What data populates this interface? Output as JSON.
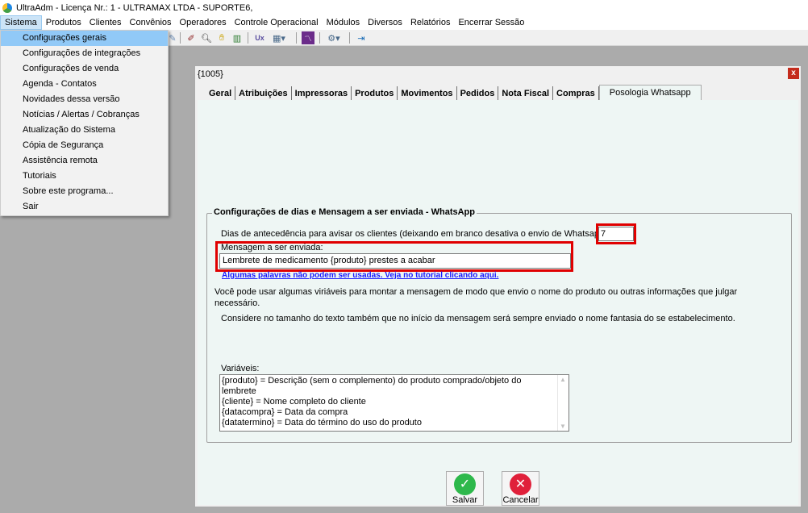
{
  "window": {
    "title": "UltraAdm - Licença Nr.: 1 - ULTRAMAX LTDA - SUPORTE6,"
  },
  "menubar": [
    "Sistema",
    "Produtos",
    "Clientes",
    "Convênios",
    "Operadores",
    "Controle Operacional",
    "Módulos",
    "Diversos",
    "Relatórios",
    "Encerrar Sessão"
  ],
  "dropdown": {
    "items": [
      "Configurações gerais",
      "Configurações de integrações",
      "Configurações de venda",
      "Agenda - Contatos",
      "Novidades dessa versão",
      "Notícias / Alertas / Cobranças",
      "Atualização do Sistema",
      "Cópia de Segurança",
      "Assistência remota",
      "Tutoriais",
      "Sobre este programa...",
      "Sair"
    ],
    "highlighted": "Configurações gerais"
  },
  "dialog": {
    "title": "{1005}",
    "close": "x",
    "tabs": [
      "Geral",
      "Atribuições",
      "Impressoras",
      "Produtos",
      "Movimentos",
      "Pedidos",
      "Nota Fiscal",
      "Compras",
      "Posologia Whatsapp"
    ],
    "active_tab": "Posologia Whatsapp",
    "group_title": "Configurações de dias e Mensagem a ser enviada - WhatsApp",
    "dias_label": "Dias de antecedência para avisar os clientes (deixando em branco desativa o envio de Whatsapp)",
    "dias_value": "7",
    "mensagem_label": "Mensagem a ser enviada:",
    "mensagem_value": "Lembrete de medicamento {produto} prestes a acabar",
    "link": "Algumas palavras não podem ser usadas. Veja no tutorial clicando aqui.",
    "info1": "Você pode usar algumas viriáveis para montar a mensagem de modo que envio o nome do produto ou outras informações que julgar necessário.",
    "info2": "Considere no tamanho do texto também que no início da mensagem será sempre enviado o nome fantasia do se estabelecimento.",
    "variaveis_label": "Variáveis:",
    "variaveis": [
      "{produto} = Descrição (sem o complemento) do produto comprado/objeto do lembrete",
      "{cliente} = Nome completo do cliente",
      "{datacompra} = Data da compra",
      "{datatermino} = Data do término do uso do produto"
    ],
    "buttons": {
      "save": "Salvar",
      "cancel": "Cancelar"
    }
  },
  "colors": {
    "highlight": "#91c9f7",
    "panel": "#eef6f4",
    "annotation_red": "#e00000",
    "save_green": "#2eb84b",
    "cancel_red": "#e0203a",
    "link_blue": "#1a1aff"
  }
}
